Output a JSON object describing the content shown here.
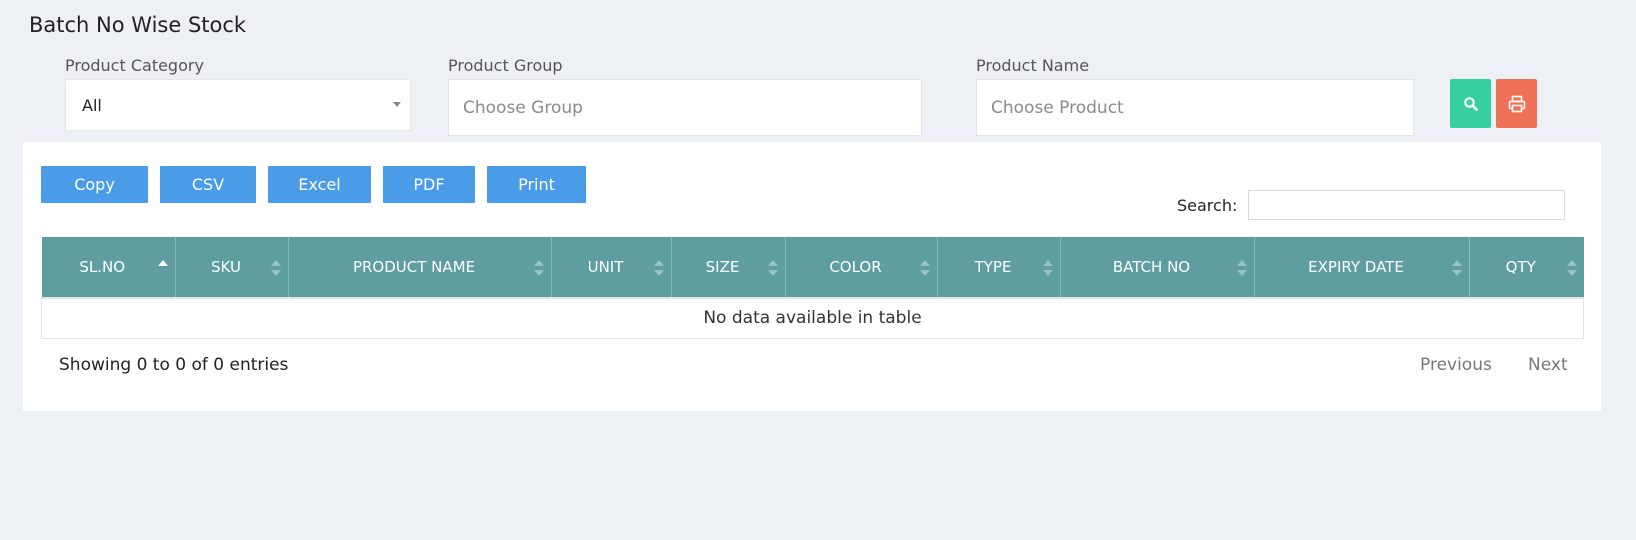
{
  "page": {
    "title": "Batch No Wise Stock"
  },
  "filters": {
    "category_label": "Product Category",
    "category_value": "All",
    "group_label": "Product Group",
    "group_placeholder": "Choose Group",
    "product_label": "Product Name",
    "product_placeholder": "Choose Product",
    "search_icon": "search-icon",
    "print_icon": "print-icon"
  },
  "colors": {
    "search_button": "#36cfa0",
    "print_button": "#ef7258",
    "export_button": "#4b9ce8",
    "table_header": "#5f9ea0"
  },
  "toolbar": {
    "buttons": [
      "Copy",
      "CSV",
      "Excel",
      "PDF",
      "Print"
    ],
    "search_label": "Search:"
  },
  "table": {
    "columns": [
      "SL.NO",
      "SKU",
      "PRODUCT NAME",
      "UNIT",
      "SIZE",
      "COLOR",
      "TYPE",
      "BATCH NO",
      "EXPIRY DATE",
      "QTY"
    ],
    "empty_message": "No data available in table",
    "sorted_column": "SL.NO",
    "sort_direction": "ascending"
  },
  "footer": {
    "info": "Showing 0 to 0 of 0 entries",
    "previous": "Previous",
    "next": "Next"
  }
}
